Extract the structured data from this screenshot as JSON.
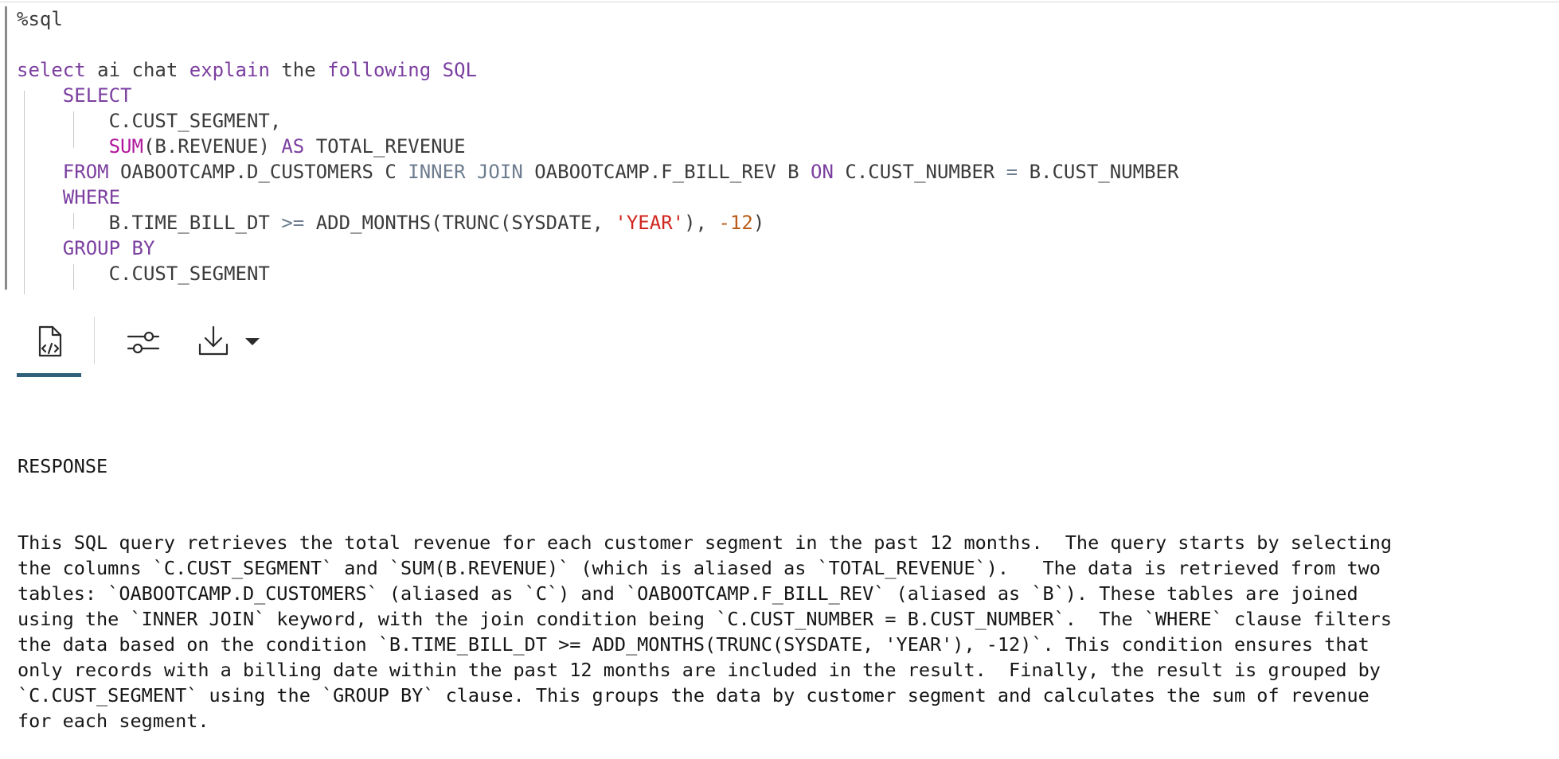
{
  "editor": {
    "magic": "%sql",
    "code_lines": [
      [
        {
          "t": "%sql",
          "c": "plain"
        }
      ],
      [],
      [
        {
          "t": "select",
          "c": "kw"
        },
        {
          "t": " ai chat ",
          "c": "plain"
        },
        {
          "t": "explain",
          "c": "kw"
        },
        {
          "t": " the ",
          "c": "plain"
        },
        {
          "t": "following",
          "c": "kw"
        },
        {
          "t": " ",
          "c": "plain"
        },
        {
          "t": "SQL",
          "c": "kw"
        }
      ],
      [
        {
          "t": "    ",
          "c": "plain"
        },
        {
          "t": "SELECT",
          "c": "kw"
        }
      ],
      [
        {
          "t": "        C.CUST_SEGMENT,",
          "c": "plain"
        }
      ],
      [
        {
          "t": "        ",
          "c": "plain"
        },
        {
          "t": "SUM",
          "c": "fn"
        },
        {
          "t": "(B.REVENUE) ",
          "c": "plain"
        },
        {
          "t": "AS",
          "c": "kw"
        },
        {
          "t": " TOTAL_REVENUE",
          "c": "plain"
        }
      ],
      [
        {
          "t": "    ",
          "c": "plain"
        },
        {
          "t": "FROM",
          "c": "kw"
        },
        {
          "t": " OABOOTCAMP.D_CUSTOMERS C ",
          "c": "plain"
        },
        {
          "t": "INNER JOIN",
          "c": "op"
        },
        {
          "t": " OABOOTCAMP.F_BILL_REV B ",
          "c": "plain"
        },
        {
          "t": "ON",
          "c": "kw"
        },
        {
          "t": " C.CUST_NUMBER ",
          "c": "plain"
        },
        {
          "t": "=",
          "c": "op"
        },
        {
          "t": " B.CUST_NUMBER",
          "c": "plain"
        }
      ],
      [
        {
          "t": "    ",
          "c": "plain"
        },
        {
          "t": "WHERE",
          "c": "kw"
        }
      ],
      [
        {
          "t": "        B.TIME_BILL_DT ",
          "c": "plain"
        },
        {
          "t": ">=",
          "c": "op"
        },
        {
          "t": " ADD_MONTHS(TRUNC(SYSDATE, ",
          "c": "plain"
        },
        {
          "t": "'YEAR'",
          "c": "str"
        },
        {
          "t": "), ",
          "c": "plain"
        },
        {
          "t": "-12",
          "c": "num"
        },
        {
          "t": ")",
          "c": "plain"
        }
      ],
      [
        {
          "t": "    ",
          "c": "plain"
        },
        {
          "t": "GROUP BY",
          "c": "kw"
        }
      ],
      [
        {
          "t": "        C.CUST_SEGMENT",
          "c": "plain"
        }
      ]
    ]
  },
  "toolbar": {
    "buttons": [
      {
        "name": "view-source-tab",
        "icon": "code-document-icon"
      },
      {
        "name": "settings-button",
        "icon": "sliders-icon"
      },
      {
        "name": "download-button",
        "icon": "download-icon"
      },
      {
        "name": "download-menu-button",
        "icon": "caret-down-icon"
      }
    ]
  },
  "response": {
    "header": "RESPONSE",
    "lines": [
      "This SQL query retrieves the total revenue for each customer segment in the past 12 months.  The query starts by selecting",
      "the columns `C.CUST_SEGMENT` and `SUM(B.REVENUE)` (which is aliased as `TOTAL_REVENUE`).   The data is retrieved from two",
      "tables: `OABOOTCAMP.D_CUSTOMERS` (aliased as `C`) and `OABOOTCAMP.F_BILL_REV` (aliased as `B`). These tables are joined",
      "using the `INNER JOIN` keyword, with the join condition being `C.CUST_NUMBER = B.CUST_NUMBER`.  The `WHERE` clause filters",
      "the data based on the condition `B.TIME_BILL_DT >= ADD_MONTHS(TRUNC(SYSDATE, 'YEAR'), -12)`. This condition ensures that",
      "only records with a billing date within the past 12 months are included in the result.  Finally, the result is grouped by",
      "`C.CUST_SEGMENT` using the `GROUP BY` clause. This groups the data by customer segment and calculates the sum of revenue",
      "for each segment."
    ]
  },
  "colors": {
    "keyword": "#7b3fa0",
    "function": "#b0179c",
    "operator": "#6e7d8f",
    "string": "#d1261f",
    "number": "#b85c18",
    "text": "#3b3b3b",
    "active_tab": "#2f5f7a"
  }
}
